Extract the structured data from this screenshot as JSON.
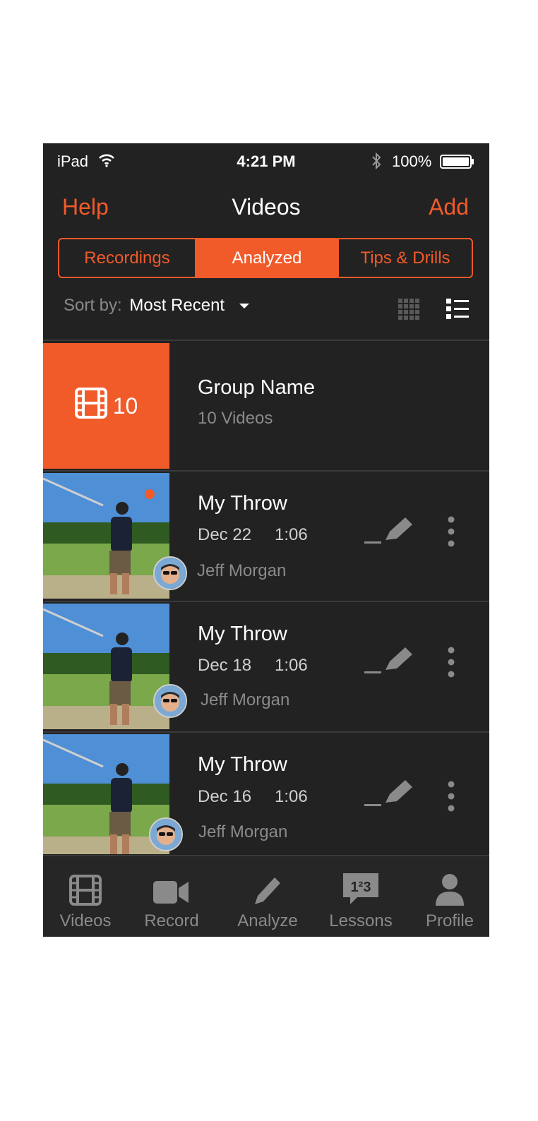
{
  "status_bar": {
    "carrier": "iPad",
    "time": "4:21 PM",
    "battery": "100%"
  },
  "nav": {
    "left": "Help",
    "title": "Videos",
    "right": "Add"
  },
  "segments": [
    "Recordings",
    "Analyzed",
    "Tips & Drills"
  ],
  "selected_segment": "Analyzed",
  "sort": {
    "label": "Sort by:",
    "value": "Most Recent"
  },
  "group": {
    "count": "10",
    "name": "Group Name",
    "subtitle": "10 Videos"
  },
  "videos": [
    {
      "title": "My Throw",
      "date": "Dec 22",
      "duration": "1:06",
      "user": "Jeff Morgan",
      "new": true
    },
    {
      "title": "My Throw",
      "date": "Dec 18",
      "duration": "1:06",
      "user": "Jeff Morgan",
      "new": false
    },
    {
      "title": "My Throw",
      "date": "Dec 16",
      "duration": "1:06",
      "user": "Jeff Morgan",
      "new": false
    }
  ],
  "tabs": [
    "Videos",
    "Record",
    "Analyze",
    "Lessons",
    "Profile"
  ],
  "colors": {
    "accent": "#f15a29",
    "background": "#222222",
    "tab_bar": "#262626"
  }
}
